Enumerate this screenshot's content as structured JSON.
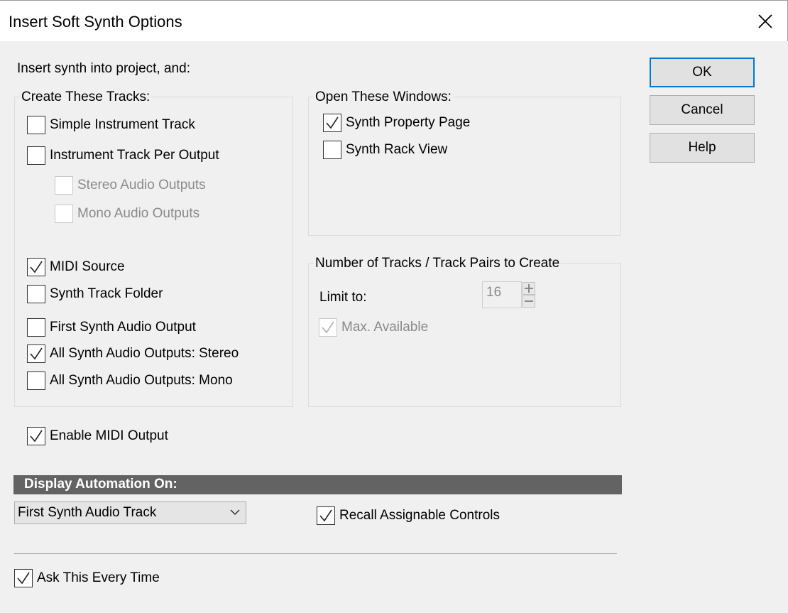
{
  "window": {
    "title": "Insert Soft Synth Options"
  },
  "intro": "Insert synth into project, and:",
  "create_tracks": {
    "title": "Create These Tracks:",
    "simple_instrument": {
      "label": "Simple Instrument Track",
      "checked": false
    },
    "instrument_per_output": {
      "label": "Instrument Track Per Output",
      "checked": false
    },
    "stereo_outputs": {
      "label": "Stereo Audio Outputs",
      "checked": false,
      "disabled": true
    },
    "mono_outputs": {
      "label": "Mono Audio Outputs",
      "checked": false,
      "disabled": true
    },
    "midi_source": {
      "label": "MIDI Source",
      "checked": true
    },
    "synth_track_folder": {
      "label": "Synth Track Folder",
      "checked": false
    },
    "first_synth_audio": {
      "label": "First Synth Audio Output",
      "checked": false
    },
    "all_stereo": {
      "label": "All Synth Audio Outputs: Stereo",
      "checked": true
    },
    "all_mono": {
      "label": "All Synth Audio Outputs: Mono",
      "checked": false
    }
  },
  "open_windows": {
    "title": "Open These Windows:",
    "property_page": {
      "label": "Synth Property Page",
      "checked": true
    },
    "rack_view": {
      "label": "Synth Rack View",
      "checked": false
    }
  },
  "track_count": {
    "title": "Number of Tracks / Track Pairs to Create",
    "limit_label": "Limit to:",
    "limit_value": "16",
    "max_available": {
      "label": "Max. Available",
      "checked": true,
      "disabled": true
    }
  },
  "enable_midi_output": {
    "label": "Enable MIDI Output",
    "checked": true
  },
  "automation": {
    "title": "Display Automation On:",
    "selected": "First Synth Audio Track",
    "recall_controls": {
      "label": "Recall Assignable Controls",
      "checked": true
    }
  },
  "ask_every_time": {
    "label": "Ask This Every Time",
    "checked": true
  },
  "buttons": {
    "ok": "OK",
    "cancel": "Cancel",
    "help": "Help"
  },
  "colors": {
    "accent": "#0078d7",
    "section_bar": "#636363",
    "background": "#f0f0f0"
  }
}
